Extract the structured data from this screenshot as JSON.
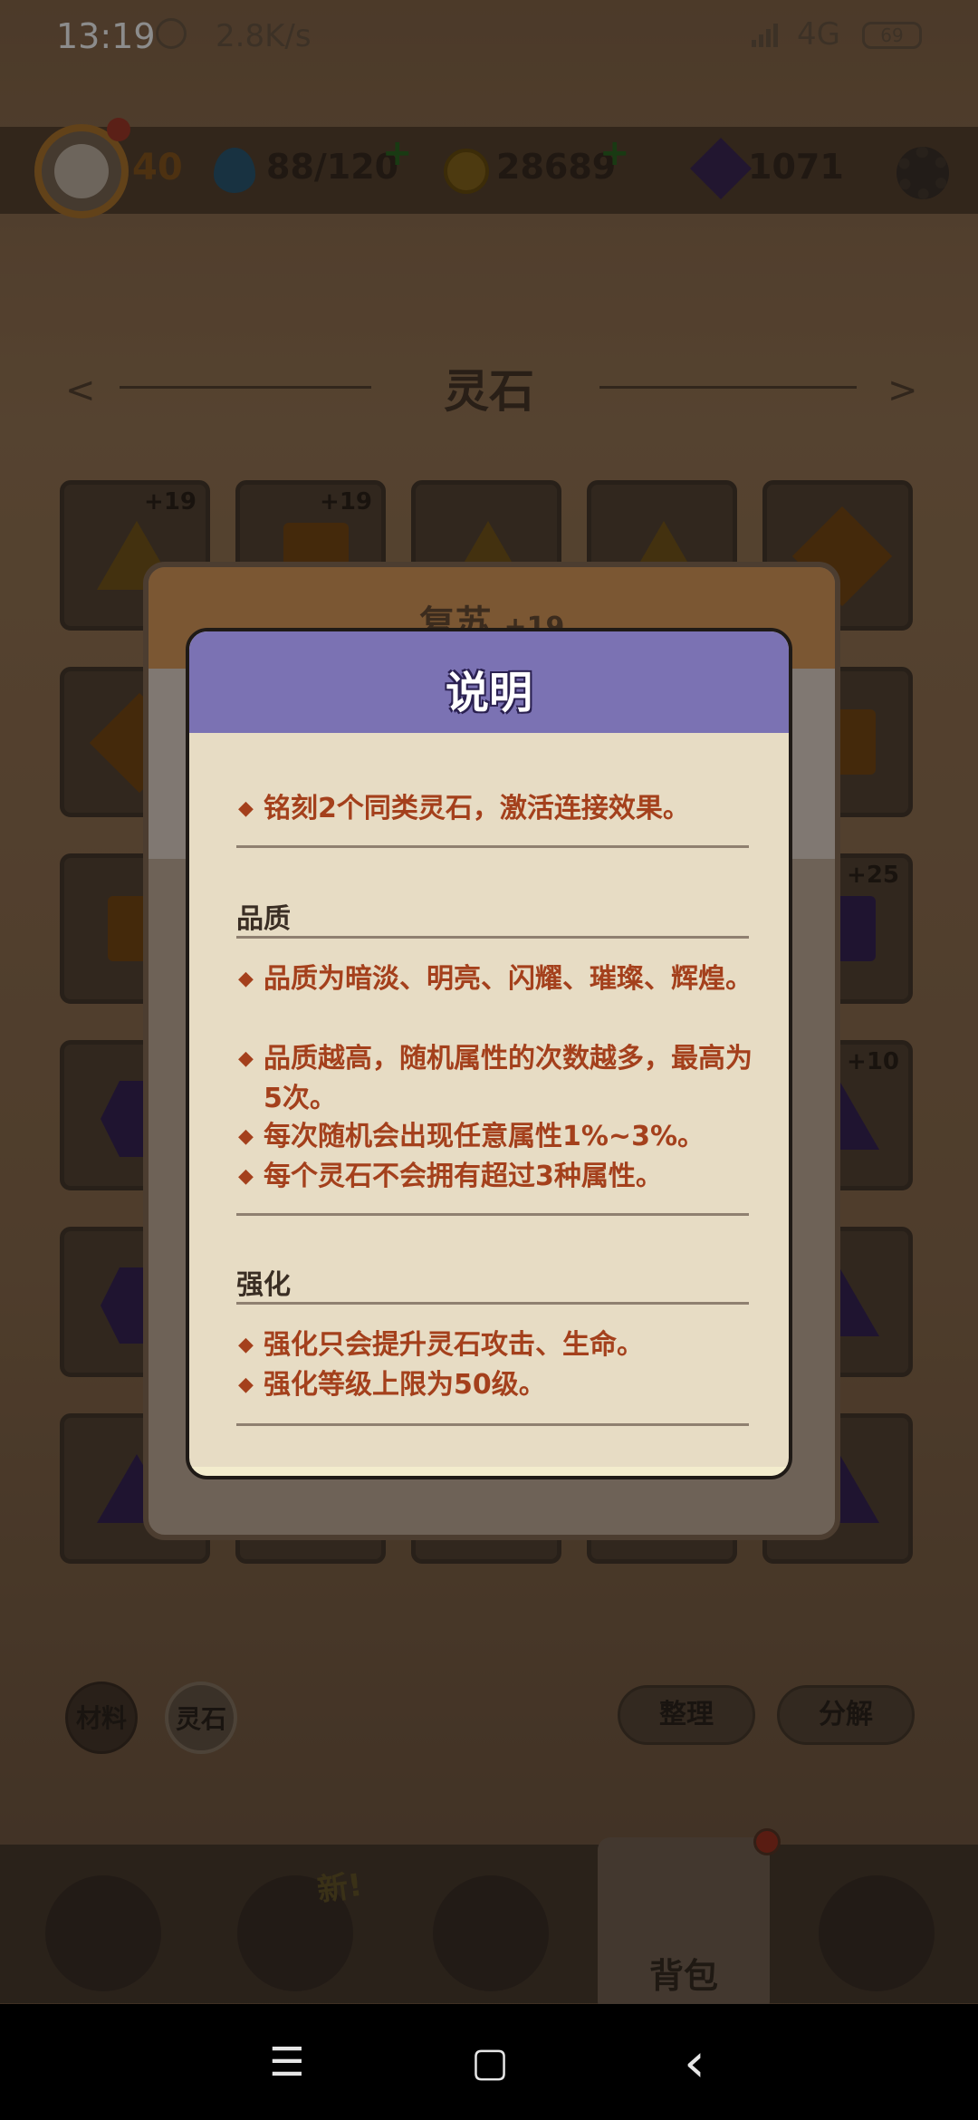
{
  "status_bar": {
    "time": "13:19",
    "net_speed": "2.8K/s",
    "network": "4G",
    "battery": "69"
  },
  "top_bar": {
    "level": "40",
    "energy": "88/120",
    "coins": "28689",
    "gems": "1071",
    "plus": "+"
  },
  "section": {
    "title": "灵石"
  },
  "grid_levels": [
    "+19",
    "+19",
    "+25",
    "+10"
  ],
  "background_panel": {
    "title": "复苏",
    "level": "+19"
  },
  "dialog": {
    "title": "说明",
    "intro": "铭刻2个同类灵石，激活连接效果。",
    "quality": {
      "label": "品质",
      "items": [
        "品质为暗淡、明亮、闪耀、璀璨、辉煌。",
        "品质越高，随机属性的次数越多，最高为5次。",
        "每次随机会出现任意属性1%~3%。",
        "每个灵石不会拥有超过3种属性。"
      ]
    },
    "enhance": {
      "label": "强化",
      "items": [
        "强化只会提升灵石攻击、生命。",
        "强化等级上限为50级。"
      ]
    }
  },
  "filters": {
    "materials": "材料",
    "spirit_stone": "灵石"
  },
  "actions": {
    "sort": "整理",
    "decompose": "分解"
  },
  "bottom_nav": {
    "new_tag": "新!",
    "bag": "背包"
  },
  "system_nav": {
    "menu": "☰",
    "home": "▢",
    "back": "‹"
  }
}
